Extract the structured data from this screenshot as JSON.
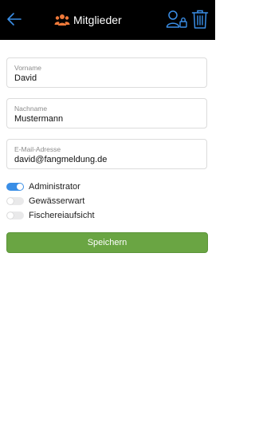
{
  "header": {
    "title": "Mitglieder",
    "back_icon": "arrow-left-icon",
    "title_icon": "users-icon",
    "user_icon": "user-lock-icon",
    "delete_icon": "trash-icon",
    "accent_color": "#3a8ee6",
    "title_icon_color": "#f07a3a"
  },
  "form": {
    "first_name": {
      "label": "Vorname",
      "value": "David"
    },
    "last_name": {
      "label": "Nachname",
      "value": "Mustermann"
    },
    "email": {
      "label": "E-Mail-Adresse",
      "value": "david@fangmeldung.de"
    }
  },
  "toggles": [
    {
      "label": "Administrator",
      "on": true
    },
    {
      "label": "Gewässerwart",
      "on": false
    },
    {
      "label": "Fischereiaufsicht",
      "on": false
    }
  ],
  "save_label": "Speichern",
  "save_color": "#6aa543"
}
